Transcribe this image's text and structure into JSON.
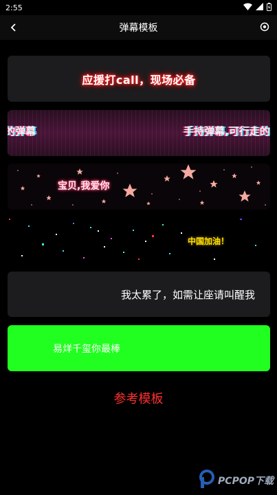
{
  "status_bar": {
    "time": "2:55"
  },
  "app_bar": {
    "title": "弹幕模板"
  },
  "templates": {
    "neon_red": {
      "text": "应援打call，现场必备"
    },
    "glitch": {
      "text_left": "的弹幕",
      "text_right": "手持弹幕,可行走的"
    },
    "stars": {
      "text": "宝贝,我爱你"
    },
    "particles": {
      "text": "中国加油！"
    },
    "plain": {
      "text": "我太累了，如需让座请叫醒我"
    },
    "green": {
      "text": "易烊千玺你最棒"
    }
  },
  "reference_link": {
    "label": "参考模板"
  },
  "watermark": {
    "text": "PCPOP下载"
  },
  "colors": {
    "background": "#000000",
    "card_dark": "#1c1c1e",
    "green_card": "#20ff1f",
    "link_red": "#ff2f2f",
    "neon_yellow": "#ffe100"
  }
}
